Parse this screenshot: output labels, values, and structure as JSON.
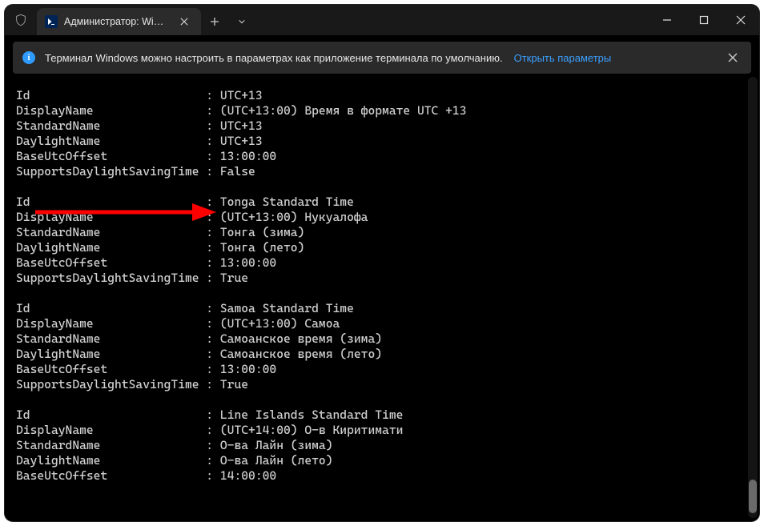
{
  "titlebar": {
    "tab_title": "Администратор: Windows Po",
    "icon_semantic": "powershell-icon"
  },
  "infobar": {
    "message": "Терминал Windows можно настроить в параметрах как приложение терминала по умолчанию.",
    "link": "Открыть параметры"
  },
  "terminal": {
    "keys": [
      "Id",
      "DisplayName",
      "StandardName",
      "DaylightName",
      "BaseUtcOffset",
      "SupportsDaylightSavingTime"
    ],
    "blocks": [
      {
        "Id": "UTC+13",
        "DisplayName": "(UTC+13:00) Время в формате UTC +13",
        "StandardName": "UTC+13",
        "DaylightName": "UTC+13",
        "BaseUtcOffset": "13:00:00",
        "SupportsDaylightSavingTime": "False"
      },
      {
        "Id": "Tonga Standard Time",
        "DisplayName": "(UTC+13:00) Нукуалофа",
        "StandardName": "Тонга (зима)",
        "DaylightName": "Тонга (лето)",
        "BaseUtcOffset": "13:00:00",
        "SupportsDaylightSavingTime": "True"
      },
      {
        "Id": "Samoa Standard Time",
        "DisplayName": "(UTC+13:00) Самоа",
        "StandardName": "Самоанское время (зима)",
        "DaylightName": "Самоанское время (лето)",
        "BaseUtcOffset": "13:00:00",
        "SupportsDaylightSavingTime": "True"
      },
      {
        "Id": "Line Islands Standard Time",
        "DisplayName": "(UTC+14:00) О-в Киритимати",
        "StandardName": "О-ва Лайн (зима)",
        "DaylightName": "О-ва Лайн (лето)",
        "BaseUtcOffset": "14:00:00"
      }
    ]
  },
  "annotation": {
    "semantic": "red-arrow-pointing-right"
  }
}
